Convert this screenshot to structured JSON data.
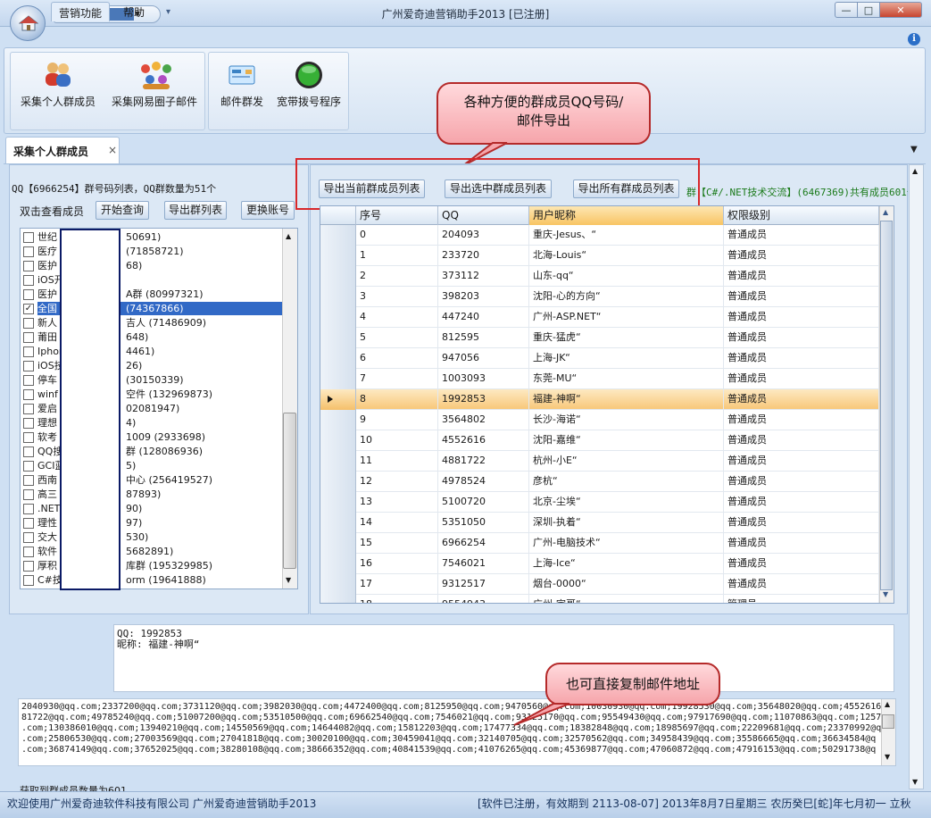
{
  "window": {
    "title": "广州爱奇迪营销助手2013 [已注册]",
    "skin_value": "界面风格",
    "min_label": "0",
    "max_label": "1",
    "close_label": "r"
  },
  "ribbon": {
    "tabs": [
      "营销功能",
      "帮助"
    ],
    "buttons": [
      "采集个人群成员",
      "采集网易圈子邮件",
      "邮件群发",
      "宽带拨号程序"
    ]
  },
  "doc_tab": {
    "label": "采集个人群成员",
    "close": "×"
  },
  "left": {
    "qq_info": "QQ【6966254】群号码列表，QQ群数量为51个",
    "dbl_label": "双击查看成员",
    "btn_start": "开始查询",
    "btn_export_groups": "导出群列表",
    "btn_change_account": "更换账号",
    "groups": [
      {
        "a": "世纪",
        "b": "50691)",
        "checked": false
      },
      {
        "a": "医疗",
        "b": "(71858721)",
        "checked": false
      },
      {
        "a": "医护",
        "b": "68)",
        "checked": false
      },
      {
        "a": "iOS开",
        "b": "",
        "checked": false
      },
      {
        "a": "医护",
        "b": "A群 (80997321)",
        "checked": false
      },
      {
        "a": "全国",
        "b": "(74367866)",
        "checked": true
      },
      {
        "a": "新人",
        "b": "吉人 (71486909)",
        "checked": false
      },
      {
        "a": "莆田",
        "b": "648)",
        "checked": false
      },
      {
        "a": "Iphon",
        "b": "4461)",
        "checked": false
      },
      {
        "a": "iOS技",
        "b": "26)",
        "checked": false
      },
      {
        "a": "停车",
        "b": "(30150339)",
        "checked": false
      },
      {
        "a": "winf",
        "b": "空件 (132969873)",
        "checked": false
      },
      {
        "a": "爱启",
        "b": "02081947)",
        "checked": false
      },
      {
        "a": "理想",
        "b": "4)",
        "checked": false
      },
      {
        "a": "软考",
        "b": "1009 (2933698)",
        "checked": false
      },
      {
        "a": "QQ搜",
        "b": "群 (128086936)",
        "checked": false
      },
      {
        "a": "GCI蓝",
        "b": "5)",
        "checked": false
      },
      {
        "a": "西南",
        "b": "中心 (256419527)",
        "checked": false
      },
      {
        "a": "高三",
        "b": "87893)",
        "checked": false
      },
      {
        "a": ".NET",
        "b": "90)",
        "checked": false
      },
      {
        "a": "理性",
        "b": "97)",
        "checked": false
      },
      {
        "a": "交大",
        "b": "530)",
        "checked": false
      },
      {
        "a": "软件",
        "b": "5682891)",
        "checked": false
      },
      {
        "a": "厚积",
        "b": "库群 (195329985)",
        "checked": false
      },
      {
        "a": "C#技",
        "b": "orm (19641888)",
        "checked": false
      }
    ]
  },
  "right": {
    "btn_export_current": "导出当前群成员列表",
    "btn_export_selected": "导出选中群成员列表",
    "btn_export_all": "导出所有群成员列表",
    "group_note": "群【C#/.NET技术交流】(6467369)共有成员601个",
    "columns": [
      "序号",
      "QQ",
      "用户昵称",
      "权限级别"
    ],
    "rows": [
      [
        "0",
        "204093",
        "重庆-Jesus、“",
        "普通成员"
      ],
      [
        "1",
        "233720",
        "北海-Louis“",
        "普通成员"
      ],
      [
        "2",
        "373112",
        "山东-qq“",
        "普通成员"
      ],
      [
        "3",
        "398203",
        "沈阳-心的方向“",
        "普通成员"
      ],
      [
        "4",
        "447240",
        "广州-ASP.NET“",
        "普通成员"
      ],
      [
        "5",
        "812595",
        "重庆-猛虎“",
        "普通成员"
      ],
      [
        "6",
        "947056",
        "上海-JK“",
        "普通成员"
      ],
      [
        "7",
        "1003093",
        "东莞-MU“",
        "普通成员"
      ],
      [
        "8",
        "1992853",
        "福建-神啊“",
        "普通成员"
      ],
      [
        "9",
        "3564802",
        "长沙-海诺“",
        "普通成员"
      ],
      [
        "10",
        "4552616",
        "沈阳-嘉维“",
        "普通成员"
      ],
      [
        "11",
        "4881722",
        "杭州-小E“",
        "普通成员"
      ],
      [
        "12",
        "4978524",
        "彦杭“",
        "普通成员"
      ],
      [
        "13",
        "5100720",
        "北京-尘埃“",
        "普通成员"
      ],
      [
        "14",
        "5351050",
        "深圳-执着“",
        "普通成员"
      ],
      [
        "15",
        "6966254",
        "广州-电脑技术“",
        "普通成员"
      ],
      [
        "16",
        "7546021",
        "上海-Ice“",
        "普通成员"
      ],
      [
        "17",
        "9312517",
        "烟台-0000“",
        "普通成员"
      ],
      [
        "18",
        "9554943",
        "广州-宇哥“",
        "管理员"
      ]
    ],
    "current_row": 8
  },
  "callouts": {
    "c1_line1": "各种方便的群成员QQ号码/",
    "c1_line2": "邮件导出",
    "c2": "也可直接复制邮件地址"
  },
  "detail": "QQ: 1992853\n昵称: 福建-神啊“",
  "emails": [
    "2040930@qq.com;2337200@qq.com;3731120@qq.com;3982030@qq.com;4472400@qq.com;8125950@qq.com;9470560@qq.com;10030930@qq.com;19928530@qq.com;35648020@qq.com;4552616@qq.com;48",
    "81722@qq.com;49785240@qq.com;51007200@qq.com;53510500@qq.com;69662540@qq.com;7546021@qq.com;93125170@qq.com;95549430@qq.com;97917690@qq.com;11070863@qq.com;12579451@q",
    ".com;130386010@qq.com;13940210@qq.com;14550569@qq.com;14644082@qq.com;15812203@qq.com;17477334@qq.com;18382848@qq.com;18985697@qq.com;22209681@qq.com;23370992@q",
    ".com;25806530@qq.com;27003569@qq.com;27041818@qq.com;30020100@qq.com;30459041@qq.com;32140705@qq.com;32570562@qq.com;34958439@qq.com;35586665@qq.com;36634584@q",
    ".com;36874149@qq.com;37652025@qq.com;38280108@qq.com;38666352@qq.com;40841539@qq.com;41076265@qq.com;45369877@qq.com;47060872@qq.com;47916153@qq.com;50291738@q"
  ],
  "status": {
    "count": "获取到群成员数量为601",
    "left": "欢迎使用广州爱奇迪软件科技有限公司 广州爱奇迪营销助手2013",
    "right": "[软件已注册，有效期到 2113-08-07]   2013年8月7日星期三 农历癸巳[蛇]年七月初一  立秋"
  }
}
